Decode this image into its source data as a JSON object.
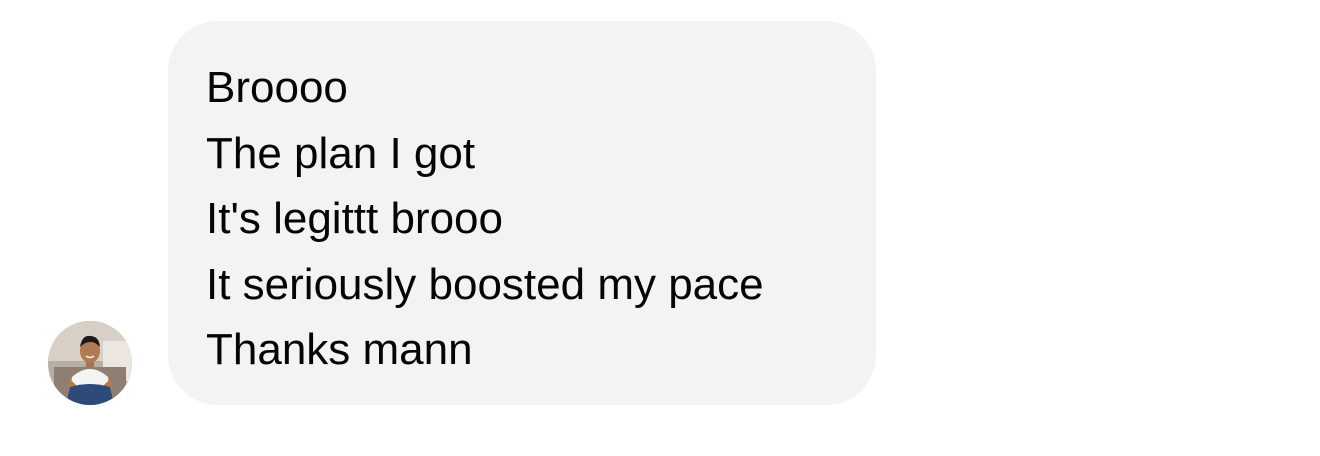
{
  "conversation": {
    "incoming_message": {
      "lines": [
        "Broooo",
        "The plan I got",
        "It's legittt brooo",
        "It seriously boosted my pace",
        "Thanks mann"
      ]
    }
  },
  "icons": {
    "avatar": "profile-photo"
  },
  "colors": {
    "bubble_background": "#f2f3f5",
    "text": "#050505",
    "page_background": "#ffffff"
  }
}
